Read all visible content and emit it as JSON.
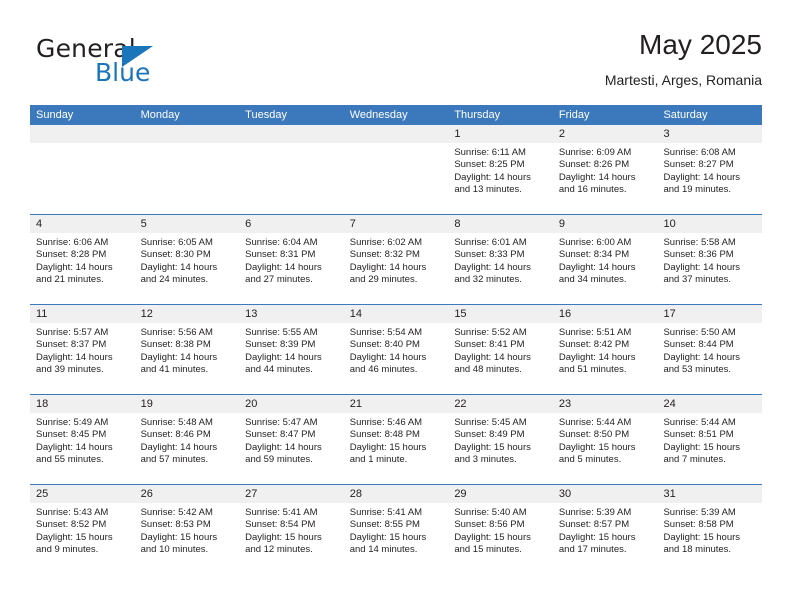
{
  "brand": {
    "name_part1": "General",
    "name_part2": "Blue",
    "accent_color": "#1b75bb"
  },
  "header": {
    "month_title": "May 2025",
    "location": "Martesti, Arges, Romania"
  },
  "calendar": {
    "header_bg": "#3c78bc",
    "daynum_bg": "#f0f0f0",
    "weekdays": [
      "Sunday",
      "Monday",
      "Tuesday",
      "Wednesday",
      "Thursday",
      "Friday",
      "Saturday"
    ],
    "weeks": [
      [
        {
          "day": "",
          "lines": []
        },
        {
          "day": "",
          "lines": []
        },
        {
          "day": "",
          "lines": []
        },
        {
          "day": "",
          "lines": []
        },
        {
          "day": "1",
          "lines": [
            "Sunrise: 6:11 AM",
            "Sunset: 8:25 PM",
            "Daylight: 14 hours",
            "and 13 minutes."
          ]
        },
        {
          "day": "2",
          "lines": [
            "Sunrise: 6:09 AM",
            "Sunset: 8:26 PM",
            "Daylight: 14 hours",
            "and 16 minutes."
          ]
        },
        {
          "day": "3",
          "lines": [
            "Sunrise: 6:08 AM",
            "Sunset: 8:27 PM",
            "Daylight: 14 hours",
            "and 19 minutes."
          ]
        }
      ],
      [
        {
          "day": "4",
          "lines": [
            "Sunrise: 6:06 AM",
            "Sunset: 8:28 PM",
            "Daylight: 14 hours",
            "and 21 minutes."
          ]
        },
        {
          "day": "5",
          "lines": [
            "Sunrise: 6:05 AM",
            "Sunset: 8:30 PM",
            "Daylight: 14 hours",
            "and 24 minutes."
          ]
        },
        {
          "day": "6",
          "lines": [
            "Sunrise: 6:04 AM",
            "Sunset: 8:31 PM",
            "Daylight: 14 hours",
            "and 27 minutes."
          ]
        },
        {
          "day": "7",
          "lines": [
            "Sunrise: 6:02 AM",
            "Sunset: 8:32 PM",
            "Daylight: 14 hours",
            "and 29 minutes."
          ]
        },
        {
          "day": "8",
          "lines": [
            "Sunrise: 6:01 AM",
            "Sunset: 8:33 PM",
            "Daylight: 14 hours",
            "and 32 minutes."
          ]
        },
        {
          "day": "9",
          "lines": [
            "Sunrise: 6:00 AM",
            "Sunset: 8:34 PM",
            "Daylight: 14 hours",
            "and 34 minutes."
          ]
        },
        {
          "day": "10",
          "lines": [
            "Sunrise: 5:58 AM",
            "Sunset: 8:36 PM",
            "Daylight: 14 hours",
            "and 37 minutes."
          ]
        }
      ],
      [
        {
          "day": "11",
          "lines": [
            "Sunrise: 5:57 AM",
            "Sunset: 8:37 PM",
            "Daylight: 14 hours",
            "and 39 minutes."
          ]
        },
        {
          "day": "12",
          "lines": [
            "Sunrise: 5:56 AM",
            "Sunset: 8:38 PM",
            "Daylight: 14 hours",
            "and 41 minutes."
          ]
        },
        {
          "day": "13",
          "lines": [
            "Sunrise: 5:55 AM",
            "Sunset: 8:39 PM",
            "Daylight: 14 hours",
            "and 44 minutes."
          ]
        },
        {
          "day": "14",
          "lines": [
            "Sunrise: 5:54 AM",
            "Sunset: 8:40 PM",
            "Daylight: 14 hours",
            "and 46 minutes."
          ]
        },
        {
          "day": "15",
          "lines": [
            "Sunrise: 5:52 AM",
            "Sunset: 8:41 PM",
            "Daylight: 14 hours",
            "and 48 minutes."
          ]
        },
        {
          "day": "16",
          "lines": [
            "Sunrise: 5:51 AM",
            "Sunset: 8:42 PM",
            "Daylight: 14 hours",
            "and 51 minutes."
          ]
        },
        {
          "day": "17",
          "lines": [
            "Sunrise: 5:50 AM",
            "Sunset: 8:44 PM",
            "Daylight: 14 hours",
            "and 53 minutes."
          ]
        }
      ],
      [
        {
          "day": "18",
          "lines": [
            "Sunrise: 5:49 AM",
            "Sunset: 8:45 PM",
            "Daylight: 14 hours",
            "and 55 minutes."
          ]
        },
        {
          "day": "19",
          "lines": [
            "Sunrise: 5:48 AM",
            "Sunset: 8:46 PM",
            "Daylight: 14 hours",
            "and 57 minutes."
          ]
        },
        {
          "day": "20",
          "lines": [
            "Sunrise: 5:47 AM",
            "Sunset: 8:47 PM",
            "Daylight: 14 hours",
            "and 59 minutes."
          ]
        },
        {
          "day": "21",
          "lines": [
            "Sunrise: 5:46 AM",
            "Sunset: 8:48 PM",
            "Daylight: 15 hours",
            "and 1 minute."
          ]
        },
        {
          "day": "22",
          "lines": [
            "Sunrise: 5:45 AM",
            "Sunset: 8:49 PM",
            "Daylight: 15 hours",
            "and 3 minutes."
          ]
        },
        {
          "day": "23",
          "lines": [
            "Sunrise: 5:44 AM",
            "Sunset: 8:50 PM",
            "Daylight: 15 hours",
            "and 5 minutes."
          ]
        },
        {
          "day": "24",
          "lines": [
            "Sunrise: 5:44 AM",
            "Sunset: 8:51 PM",
            "Daylight: 15 hours",
            "and 7 minutes."
          ]
        }
      ],
      [
        {
          "day": "25",
          "lines": [
            "Sunrise: 5:43 AM",
            "Sunset: 8:52 PM",
            "Daylight: 15 hours",
            "and 9 minutes."
          ]
        },
        {
          "day": "26",
          "lines": [
            "Sunrise: 5:42 AM",
            "Sunset: 8:53 PM",
            "Daylight: 15 hours",
            "and 10 minutes."
          ]
        },
        {
          "day": "27",
          "lines": [
            "Sunrise: 5:41 AM",
            "Sunset: 8:54 PM",
            "Daylight: 15 hours",
            "and 12 minutes."
          ]
        },
        {
          "day": "28",
          "lines": [
            "Sunrise: 5:41 AM",
            "Sunset: 8:55 PM",
            "Daylight: 15 hours",
            "and 14 minutes."
          ]
        },
        {
          "day": "29",
          "lines": [
            "Sunrise: 5:40 AM",
            "Sunset: 8:56 PM",
            "Daylight: 15 hours",
            "and 15 minutes."
          ]
        },
        {
          "day": "30",
          "lines": [
            "Sunrise: 5:39 AM",
            "Sunset: 8:57 PM",
            "Daylight: 15 hours",
            "and 17 minutes."
          ]
        },
        {
          "day": "31",
          "lines": [
            "Sunrise: 5:39 AM",
            "Sunset: 8:58 PM",
            "Daylight: 15 hours",
            "and 18 minutes."
          ]
        }
      ]
    ]
  }
}
